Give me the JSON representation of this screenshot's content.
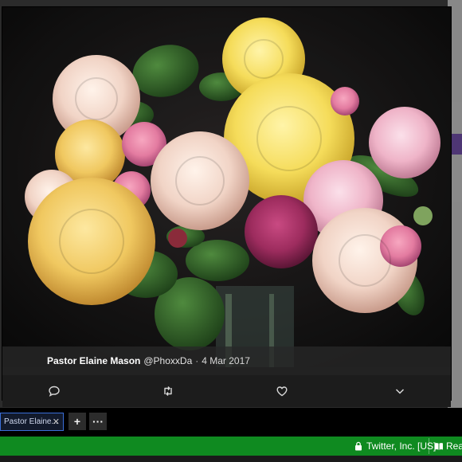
{
  "tweet": {
    "author_name": "Pastor Elaine Mason",
    "handle": "@PhoxxDa",
    "separator": "·",
    "date": "4 Mar 2017"
  },
  "media": {
    "subject": "rose-bouquet-photo"
  },
  "actions": [
    {
      "name": "reply-button",
      "icon": "speech-bubble-icon"
    },
    {
      "name": "retweet-button",
      "icon": "retweet-icon"
    },
    {
      "name": "like-button",
      "icon": "heart-icon"
    },
    {
      "name": "more-button",
      "icon": "chevron-down-icon"
    }
  ],
  "browser": {
    "tab_title": "Pastor Elaine...",
    "tab_close": "✕",
    "new_tab_label": "+",
    "more_tabs_label": "···"
  },
  "statusbar": {
    "site_identity": "Twitter, Inc. [US]",
    "reading_label": "Read",
    "color": "#0f8a20"
  },
  "colors": {
    "lightbox_bg": "#111111",
    "caption_bg": "#282828",
    "tab_border": "#3a6ed8"
  }
}
